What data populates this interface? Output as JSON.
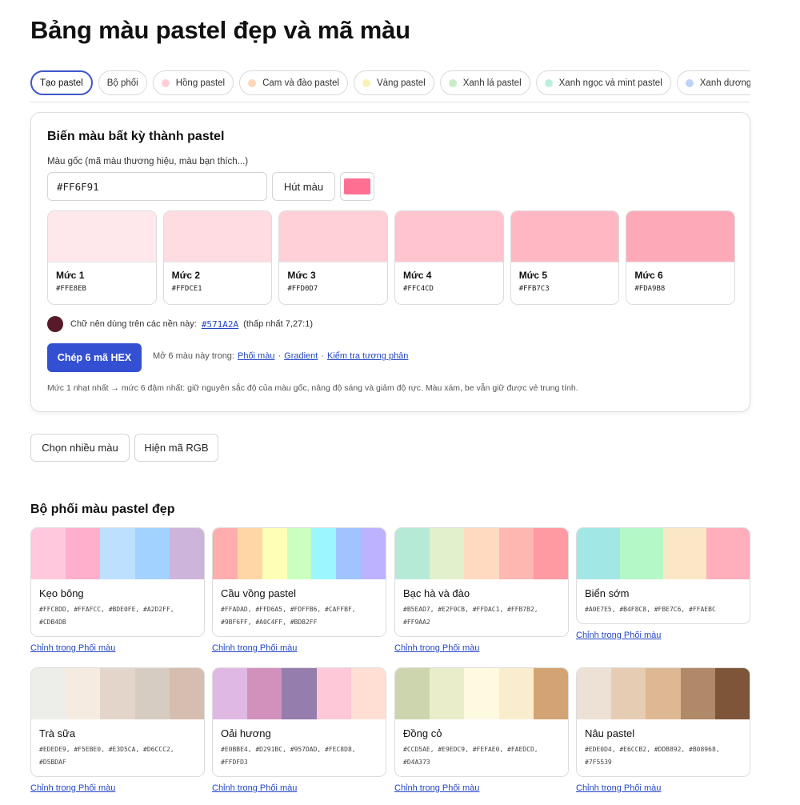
{
  "page": {
    "title": "Bảng màu pastel đẹp và mã màu"
  },
  "tabs": [
    {
      "label": "Tạo pastel",
      "dot": null,
      "active": true
    },
    {
      "label": "Bộ phối",
      "dot": null,
      "active": false
    },
    {
      "label": "Hồng pastel",
      "dot": "#FFCDD8",
      "active": false
    },
    {
      "label": "Cam và đào pastel",
      "dot": "#FFD6B8",
      "active": false
    },
    {
      "label": "Vàng pastel",
      "dot": "#FBF0B5",
      "active": false
    },
    {
      "label": "Xanh lá pastel",
      "dot": "#C8EDC6",
      "active": false
    },
    {
      "label": "Xanh ngọc và mint pastel",
      "dot": "#BDEFE0",
      "active": false
    },
    {
      "label": "Xanh dương pastel",
      "dot": "#BCD3F7",
      "active": false
    }
  ],
  "generator": {
    "title": "Biến màu bất kỳ thành pastel",
    "input_label": "Màu gốc (mã màu thương hiệu, màu bạn thích...)",
    "input_value": "#FF6F91",
    "pick_label": "Hút màu",
    "base_color": "#FF6F91",
    "levels": [
      {
        "name": "Mức 1",
        "hex": "#FFE8EB"
      },
      {
        "name": "Mức 2",
        "hex": "#FFDCE1"
      },
      {
        "name": "Mức 3",
        "hex": "#FFD0D7"
      },
      {
        "name": "Mức 4",
        "hex": "#FFC4CD"
      },
      {
        "name": "Mức 5",
        "hex": "#FFB7C3"
      },
      {
        "name": "Mức 6",
        "hex": "#FDA9B8"
      }
    ],
    "text_color_prefix": "Chữ nên dùng trên các nền này:",
    "text_color": "#571A2A",
    "text_color_note": "(thấp nhất 7,27:1)",
    "copy_label": "Chép 6 mã HEX",
    "open_prefix": "Mở 6 màu này trong:",
    "open_links": [
      "Phối màu",
      "Gradient",
      "Kiểm tra tương phản"
    ],
    "link_separator": "·",
    "note": "Mức 1 nhạt nhất → mức 6 đậm nhất: giữ nguyên sắc độ của màu gốc, nâng độ sáng và giảm độ rực. Màu xám, be vẫn giữ được vẻ trung tính."
  },
  "options": {
    "multi_label": "Chọn nhiều màu",
    "rgb_label": "Hiện mã RGB"
  },
  "palettes_section": {
    "title": "Bộ phối màu pastel đẹp",
    "edit_label": "Chỉnh trong Phối màu",
    "items": [
      {
        "name": "Kẹo bông",
        "colors": [
          "#FFC8DD",
          "#FFAFCC",
          "#BDE0FE",
          "#A2D2FF",
          "#CDB4DB"
        ],
        "codes": "#FFC8DD, #FFAFCC, #BDE0FE, #A2D2FF, #CDB4DB"
      },
      {
        "name": "Cầu vồng pastel",
        "colors": [
          "#FFADAD",
          "#FFD6A5",
          "#FDFFB6",
          "#CAFFBF",
          "#9BF6FF",
          "#A0C4FF",
          "#BDB2FF"
        ],
        "codes": "#FFADAD, #FFD6A5, #FDFFB6, #CAFFBF, #9BF6FF, #A0C4FF, #BDB2FF"
      },
      {
        "name": "Bạc hà và đào",
        "colors": [
          "#B5EAD7",
          "#E2F0CB",
          "#FFDAC1",
          "#FFB7B2",
          "#FF9AA2"
        ],
        "codes": "#B5EAD7, #E2F0CB, #FFDAC1, #FFB7B2, #FF9AA2"
      },
      {
        "name": "Biển sớm",
        "colors": [
          "#A0E7E5",
          "#B4F8C8",
          "#FBE7C6",
          "#FFAEBC"
        ],
        "codes": "#A0E7E5, #B4F8C8, #FBE7C6, #FFAEBC"
      },
      {
        "name": "Trà sữa",
        "colors": [
          "#EDEDE9",
          "#F5EBE0",
          "#E3D5CA",
          "#D6CCC2",
          "#D5BDAF"
        ],
        "codes": "#EDEDE9, #F5EBE0, #E3D5CA, #D6CCC2, #D5BDAF"
      },
      {
        "name": "Oải hương",
        "colors": [
          "#E0B8E4",
          "#D291BC",
          "#957DAD",
          "#FEC8D8",
          "#FFDFD3"
        ],
        "codes": "#E0BBE4, #D291BC, #957DAD, #FEC8D8, #FFDFD3"
      },
      {
        "name": "Đồng cỏ",
        "colors": [
          "#CCD5AE",
          "#E9EDC9",
          "#FEFAE0",
          "#FAEDCD",
          "#D4A373"
        ],
        "codes": "#CCD5AE, #E9EDC9, #FEFAE0, #FAEDCD, #D4A373"
      },
      {
        "name": "Nâu pastel",
        "colors": [
          "#EDE0D4",
          "#E6CCB2",
          "#DDB892",
          "#B08968",
          "#7F5539"
        ],
        "codes": "#EDE0D4, #E6CCB2, #DDB892, #B08968, #7F5539"
      }
    ]
  }
}
